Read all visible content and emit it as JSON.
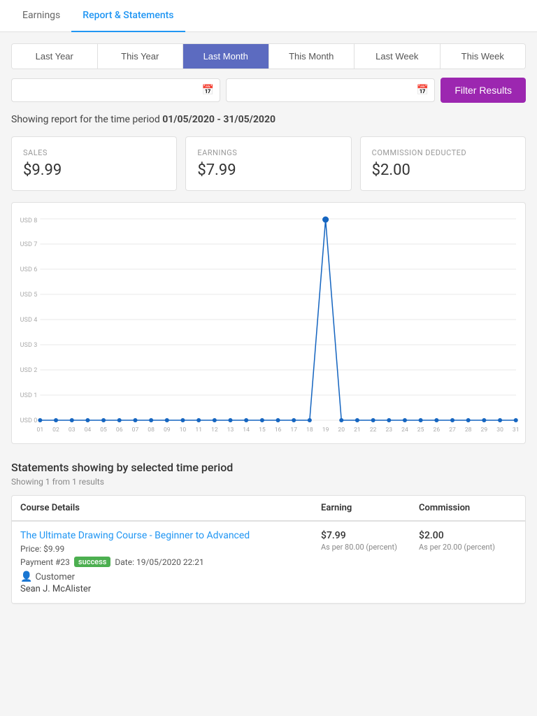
{
  "nav": {
    "items": [
      {
        "id": "earnings",
        "label": "Earnings",
        "active": false
      },
      {
        "id": "report-statements",
        "label": "Report & Statements",
        "active": true
      }
    ]
  },
  "period_tabs": [
    {
      "id": "last-year",
      "label": "Last Year",
      "active": false
    },
    {
      "id": "this-year",
      "label": "This Year",
      "active": false
    },
    {
      "id": "last-month",
      "label": "Last Month",
      "active": true
    },
    {
      "id": "this-month",
      "label": "This Month",
      "active": false
    },
    {
      "id": "last-week",
      "label": "Last Week",
      "active": false
    },
    {
      "id": "this-week",
      "label": "This Week",
      "active": false
    }
  ],
  "filter": {
    "date1_placeholder": "",
    "date2_placeholder": "",
    "button_label": "Filter Results"
  },
  "report_period": {
    "prefix": "Showing report for the time period ",
    "range": "01/05/2020 - 31/05/2020"
  },
  "stats": [
    {
      "label": "SALES",
      "value": "$9.99"
    },
    {
      "label": "EARNINGS",
      "value": "$7.99"
    },
    {
      "label": "COMMISSION DEDUCTED",
      "value": "$2.00"
    }
  ],
  "chart": {
    "y_labels": [
      "USD 8",
      "USD 7",
      "USD 6",
      "USD 5",
      "USD 4",
      "USD 3",
      "USD 2",
      "USD 1",
      "USD 0"
    ],
    "x_labels": [
      "01",
      "02",
      "03",
      "04",
      "05",
      "06",
      "07",
      "08",
      "09",
      "10",
      "11",
      "12",
      "13",
      "14",
      "15",
      "16",
      "17",
      "18",
      "19",
      "20",
      "21",
      "22",
      "23",
      "24",
      "25",
      "26",
      "27",
      "28",
      "29",
      "30",
      "31"
    ],
    "spike_day": 19,
    "spike_value": 7.99,
    "max_value": 8
  },
  "statements": {
    "section_title": "Statements showing by selected time period",
    "showing": "Showing 1 from 1 results",
    "table_headers": [
      "Course Details",
      "Earning",
      "Commission"
    ],
    "rows": [
      {
        "course_name": "The Ultimate Drawing Course - Beginner to Advanced",
        "price": "Price: $9.99",
        "payment": "Payment #23",
        "status": "success",
        "date": "Date: 19/05/2020 22:21",
        "customer_label": "Customer",
        "customer_name": "Sean J. McAlister",
        "earning_value": "$7.99",
        "earning_detail": "As per 80.00 (percent)",
        "commission_value": "$2.00",
        "commission_detail": "As per 20.00 (percent)"
      }
    ]
  }
}
